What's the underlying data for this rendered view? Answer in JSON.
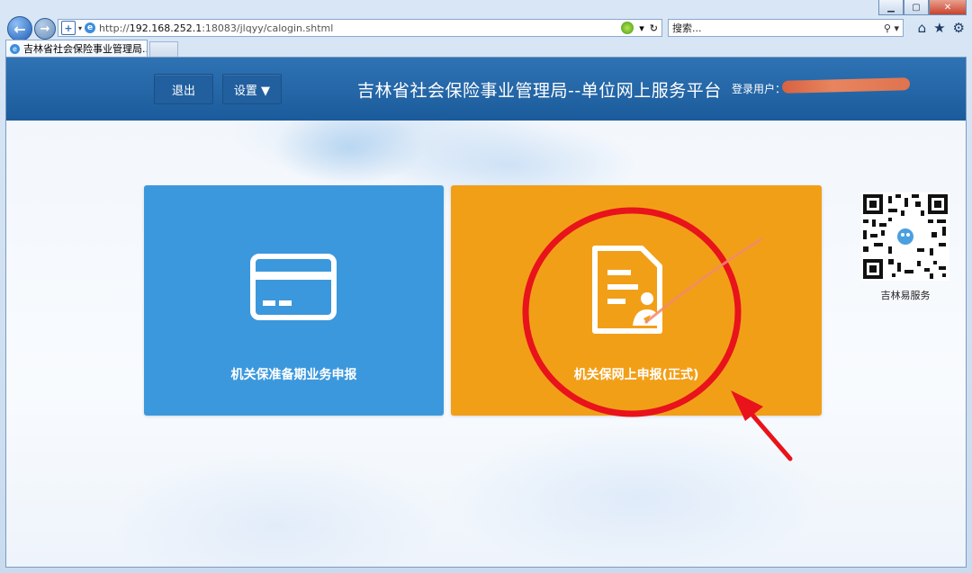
{
  "browser": {
    "url_prefix": "http://",
    "url_host": "192.168.252.1",
    "url_path": ":18083/jlqyy/calogin.shtml",
    "search_placeholder": "搜索...",
    "tab_title": "吉林省社会保险事业管理局...",
    "window_controls": [
      "minimize-icon",
      "maximize-icon",
      "close-icon"
    ],
    "toolbar_icons": [
      "home-icon",
      "favorites-star-icon",
      "gear-icon"
    ]
  },
  "header": {
    "logout_label": "退出",
    "settings_label": "设置 ▼",
    "title": "吉林省社会保险事业管理局--单位网上服务平台",
    "login_user_label": "登录用户：",
    "login_user_value": ""
  },
  "tiles": [
    {
      "label": "机关保准备期业务申报",
      "color": "#3c98dc",
      "icon": "bank-card-icon"
    },
    {
      "label": "机关保网上申报(正式)",
      "color": "#f29f18",
      "icon": "document-user-icon"
    }
  ],
  "sidebar": {
    "qr_caption": "吉林易服务"
  },
  "colors": {
    "header_blue": "#2368aa",
    "annotation_red": "#e8131b"
  }
}
